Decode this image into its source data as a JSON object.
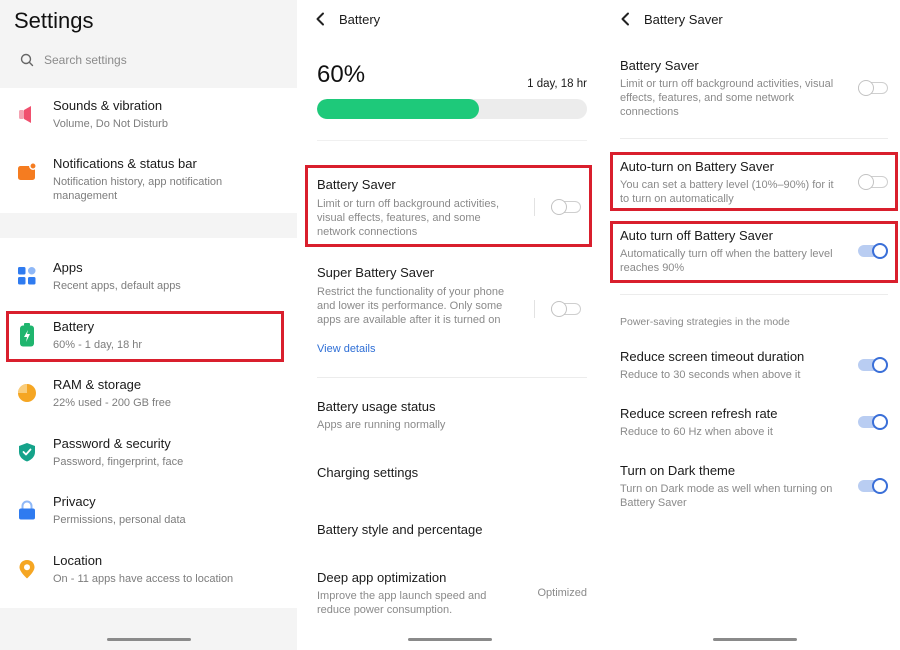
{
  "settings_panel": {
    "title": "Settings",
    "search_placeholder": "Search settings",
    "items": [
      {
        "title": "Sounds & vibration",
        "subtitle": "Volume, Do Not Disturb",
        "icon": "speaker-icon",
        "color": "#f0506e"
      },
      {
        "title": "Notifications & status bar",
        "subtitle": "Notification history, app notification management",
        "icon": "notification-icon",
        "color": "#f57c20"
      },
      {
        "title": "Apps",
        "subtitle": "Recent apps, default apps",
        "icon": "apps-grid-icon",
        "color": "#2f7bf0"
      },
      {
        "title": "Battery",
        "subtitle": "60% - 1 day, 18 hr",
        "icon": "battery-icon",
        "color": "#1fb56e"
      },
      {
        "title": "RAM & storage",
        "subtitle": "22% used - 200 GB free",
        "icon": "storage-pie-icon",
        "color": "#f5a623"
      },
      {
        "title": "Password & security",
        "subtitle": "Password, fingerprint, face",
        "icon": "shield-icon",
        "color": "#15a38a"
      },
      {
        "title": "Privacy",
        "subtitle": "Permissions, personal data",
        "icon": "lock-icon",
        "color": "#2f7bf0"
      },
      {
        "title": "Location",
        "subtitle": "On - 11 apps have access to location",
        "icon": "location-pin-icon",
        "color": "#f5a623"
      }
    ]
  },
  "battery_panel": {
    "title": "Battery",
    "percent": "60%",
    "level": 0.6,
    "remaining": "1 day, 18 hr",
    "fill_color": "#1ec97a",
    "items": [
      {
        "title": "Battery Saver",
        "subtitle": "Limit or turn off background activities, visual effects, features, and some network connections",
        "toggle": false
      },
      {
        "title": "Super Battery Saver",
        "subtitle": "Restrict the functionality of your phone and lower its performance. Only some apps are available after it is turned on",
        "link": "View details",
        "toggle": false
      },
      {
        "title": "Battery usage status",
        "subtitle": "Apps are running normally"
      },
      {
        "title": "Charging settings"
      },
      {
        "title": "Battery style and percentage"
      },
      {
        "title": "Deep app optimization",
        "subtitle": "Improve the app launch speed and reduce power consumption.",
        "value": "Optimized"
      }
    ]
  },
  "battery_saver_panel": {
    "title": "Battery Saver",
    "items": [
      {
        "title": "Battery Saver",
        "subtitle": "Limit or turn off background activities, visual effects, features, and some network connections",
        "toggle": false
      },
      {
        "title": "Auto-turn on Battery Saver",
        "subtitle": "You can set a battery level (10%–90%) for it to turn on automatically",
        "toggle": false
      },
      {
        "title": "Auto turn off Battery Saver",
        "subtitle": "Automatically turn off when the battery level reaches 90%",
        "toggle": true
      }
    ],
    "section_label": "Power-saving strategies in the mode",
    "strategies": [
      {
        "title": "Reduce screen timeout duration",
        "subtitle": "Reduce to 30 seconds when above it",
        "toggle": true
      },
      {
        "title": "Reduce screen refresh rate",
        "subtitle": "Reduce to 60 Hz when above it",
        "toggle": true
      },
      {
        "title": "Turn on Dark theme",
        "subtitle": "Turn on Dark mode as well when turning on Battery Saver",
        "toggle": true
      }
    ]
  },
  "colors": {
    "highlight": "#d91f2d",
    "toggle_on": "#3a6fd8",
    "link": "#2f6fd6"
  }
}
